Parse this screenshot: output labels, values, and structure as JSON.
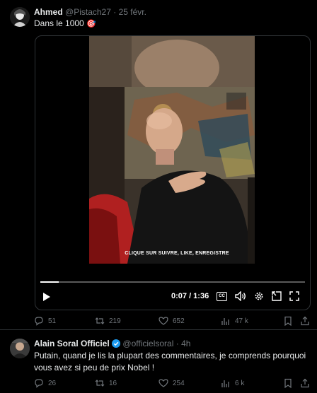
{
  "tweet1": {
    "author_name": "Ahmed",
    "handle": "@Pistach27",
    "separator": "·",
    "date": "25 févr.",
    "text": "Dans le 1000",
    "emoji": "🎯",
    "video": {
      "caption": "CLIQUE SUR SUIVRE, LIKE, ENREGISTRE",
      "time": "0:07 / 1:36",
      "cc_label": "CC",
      "progress": 0.07
    },
    "metrics": {
      "replies": "51",
      "reposts": "219",
      "likes": "652",
      "views": "47 k"
    }
  },
  "tweet2": {
    "author_name": "Alain Soral Officiel",
    "handle": "@officielsoral",
    "separator": "·",
    "time": "4h",
    "text": "Putain, quand je lis la plupart des commentaires, je comprends pourquoi vous avez si peu de prix Nobel !",
    "metrics": {
      "replies": "26",
      "reposts": "16",
      "likes": "254",
      "views": "6 k"
    }
  },
  "colors": {
    "background": "#000000",
    "text": "#e7e9ea",
    "muted": "#71767b",
    "verified": "#1d9bf0",
    "border": "#2f3336"
  }
}
